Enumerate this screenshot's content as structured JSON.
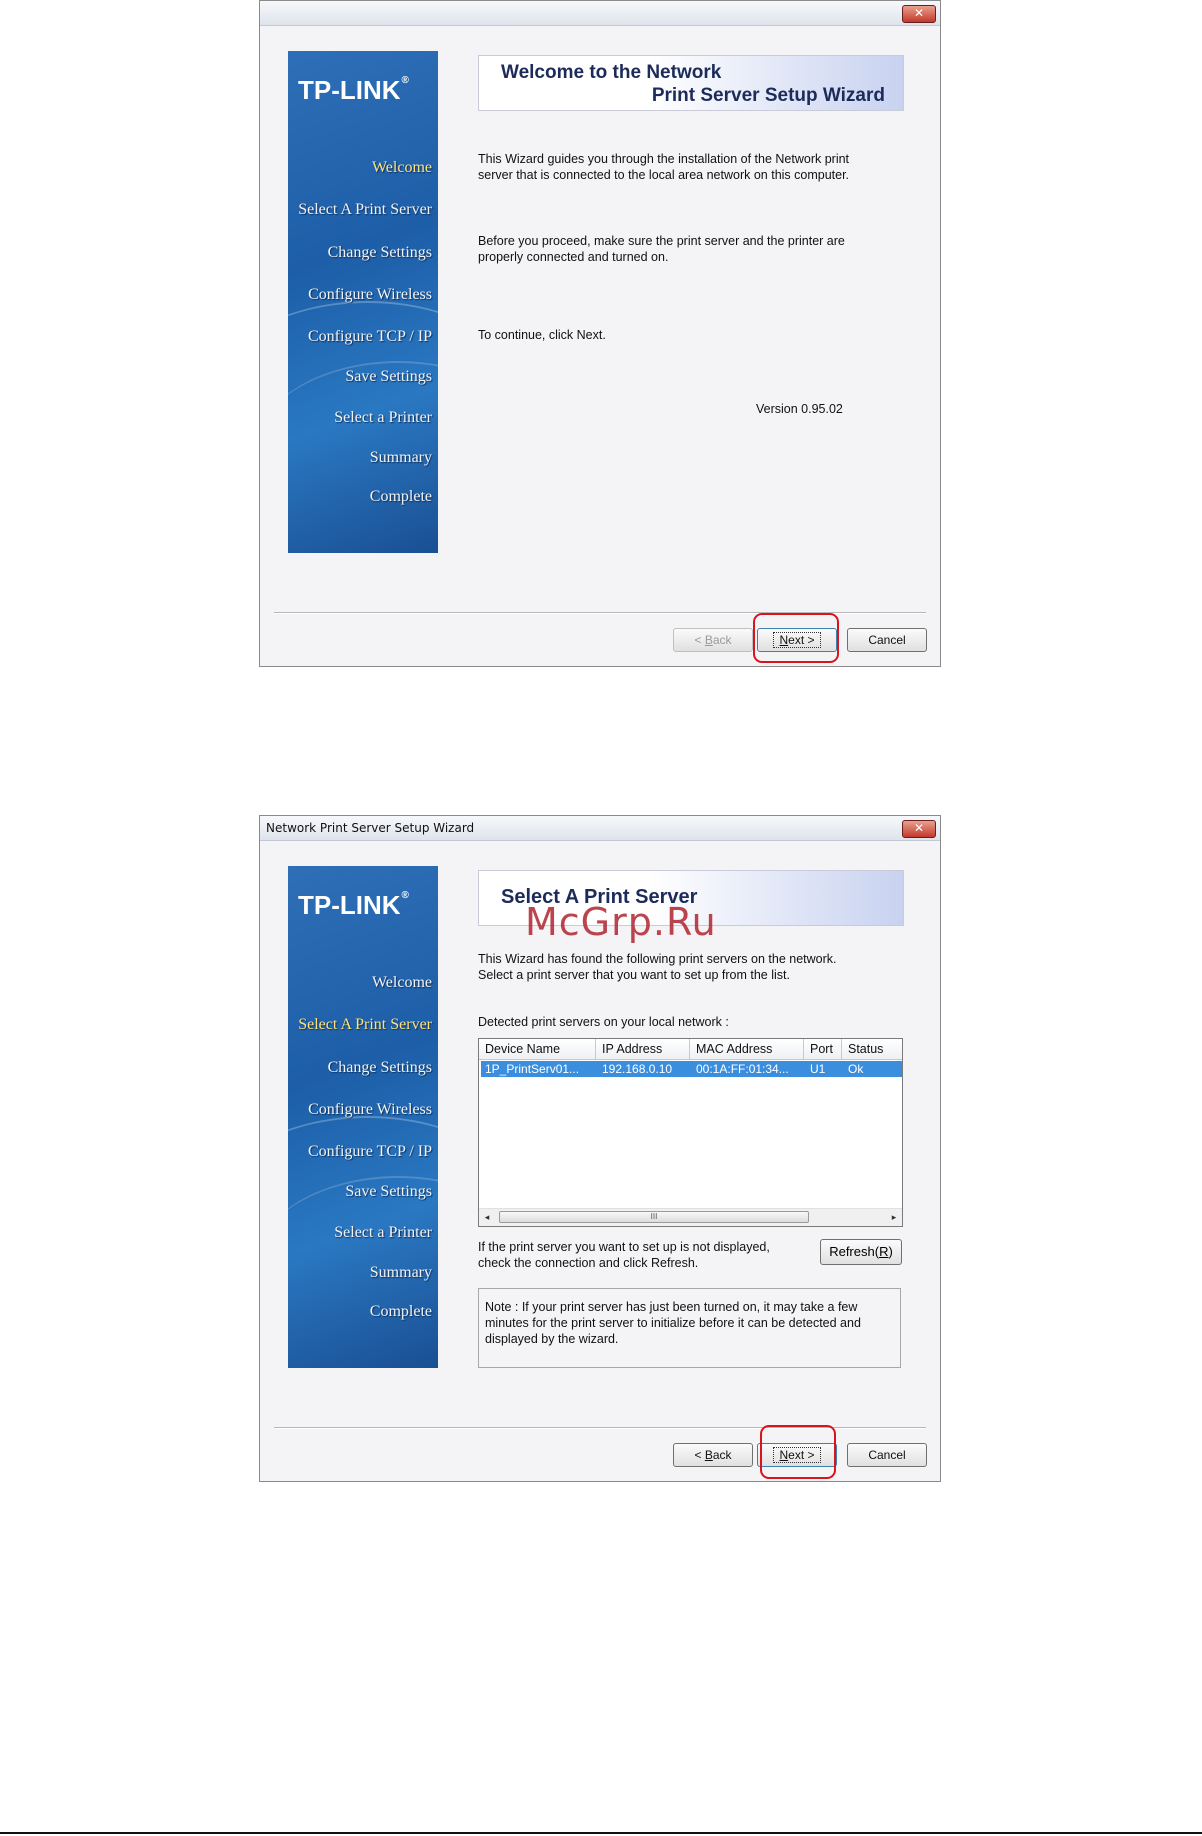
{
  "window1": {
    "title": "",
    "close_glyph": "✕",
    "logo": "TP-LINK",
    "logo_mark": "®",
    "steps": [
      "Welcome",
      "Select A Print Server",
      "Change Settings",
      "Configure Wireless",
      "Configure TCP / IP",
      "Save Settings",
      "Select a Printer",
      "Summary",
      "Complete"
    ],
    "active_step": "Welcome",
    "banner_line1": "Welcome to the Network",
    "banner_line2": "Print Server Setup Wizard",
    "para1": "This Wizard guides you through the installation of the Network print\nserver that is connected to the local area network on this computer.",
    "para2": "Before you proceed, make sure the print server and the printer are\nproperly connected and turned on.",
    "para3": "To continue, click Next.",
    "version": "Version 0.95.02",
    "buttons": {
      "back_prefix": "< ",
      "back_key": "B",
      "back_rest": "ack",
      "next_key": "N",
      "next_rest": "ext >",
      "cancel": "Cancel"
    }
  },
  "window2": {
    "title": "Network Print Server Setup Wizard",
    "close_glyph": "✕",
    "logo": "TP-LINK",
    "logo_mark": "®",
    "steps": [
      "Welcome",
      "Select A Print Server",
      "Change Settings",
      "Configure Wireless",
      "Configure TCP / IP",
      "Save Settings",
      "Select a Printer",
      "Summary",
      "Complete"
    ],
    "active_step": "Select A Print Server",
    "banner": "Select A Print Server",
    "watermark": "McGrp.Ru",
    "intro": "This Wizard has found the following print servers on the network.\nSelect a print server that you want to set up from the list.",
    "list_label": "Detected print servers on your local network :",
    "columns": [
      "Device Name",
      "IP Address",
      "MAC Address",
      "Port",
      "Status"
    ],
    "rows": [
      [
        "1P_PrintServ01...",
        "192.168.0.10",
        "00:1A:FF:01:34...",
        "U1",
        "Ok"
      ]
    ],
    "scroll_left": "◂",
    "scroll_right": "▸",
    "scroll_grip": "III",
    "refresh_hint": "If the print server you want to set up is not displayed,\ncheck the connection and click Refresh.",
    "refresh_label": "Refresh(",
    "refresh_key": "R",
    "refresh_end": ")",
    "note": "Note : If your print server has just been turned on, it may take a few\nminutes for the print server to initialize before it can be detected and\ndisplayed by the wizard.",
    "buttons": {
      "back_prefix": "< ",
      "back_key": "B",
      "back_rest": "ack",
      "next_key": "N",
      "next_rest": "ext >",
      "cancel": "Cancel"
    }
  }
}
